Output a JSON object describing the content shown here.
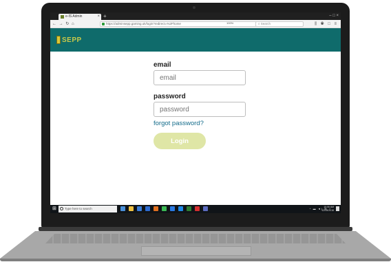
{
  "browser": {
    "tab_title": "e-IS Admin",
    "url": "https://adminsepp.gaming.uk/login?redirect=%2Fhome",
    "zoom": "100%",
    "search_placeholder": "Search"
  },
  "app": {
    "logo_text": "SEPP",
    "brand_color": "#0f6b6b"
  },
  "login": {
    "email_label": "email",
    "email_placeholder": "email",
    "password_label": "password",
    "password_placeholder": "password",
    "forgot_link": "forgot password?",
    "login_button": "Login",
    "button_color": "#dfe6a6"
  },
  "taskbar": {
    "search_placeholder": "Type here to search",
    "time": "10:06 AM",
    "date": "12/05/2018"
  }
}
